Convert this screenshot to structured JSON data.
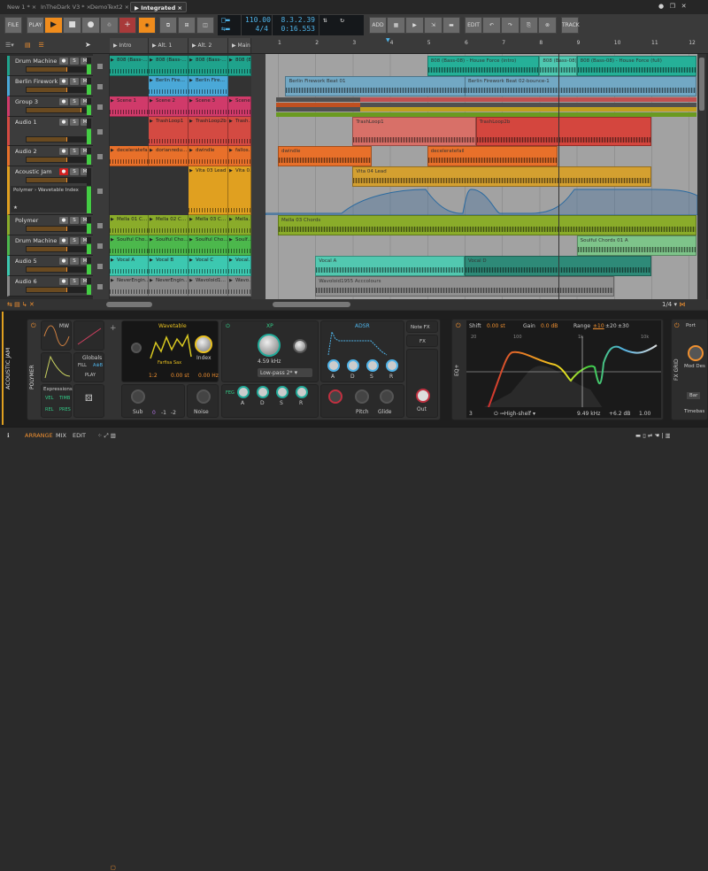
{
  "tabs": [
    {
      "label": "New 1 *"
    },
    {
      "label": "InTheDark V3 *"
    },
    {
      "label": "DemoText2"
    },
    {
      "label": "Integrated",
      "active": true
    }
  ],
  "toolbar": {
    "file": "FILE",
    "play": "PLAY",
    "add": "ADD",
    "edit": "EDIT",
    "track": "TRACK"
  },
  "transport": {
    "tempo": "110.00",
    "signature": "4/4",
    "position": "8.3.2.39",
    "time": "0:16.553"
  },
  "scenes": [
    "Intro",
    "Alt. 1",
    "Alt. 2",
    "Main"
  ],
  "ruler": [
    "1",
    "2",
    "3",
    "4",
    "5",
    "6",
    "7",
    "8",
    "9",
    "10",
    "11",
    "12"
  ],
  "colors": {
    "accent": "#f08c1c",
    "background": "#2b2b2b",
    "arranger": "#a0a0a0"
  },
  "tracks": [
    {
      "name": "Drum Machine",
      "color": "#1fa38c",
      "cells": [
        "808 (Bass-…",
        "808 (Bass-…",
        "808 (Bass-…",
        "808 (B…"
      ]
    },
    {
      "name": "Berlin Firework Kit",
      "color": "#4aa8d8",
      "cells": [
        "",
        "Berlin Fire…",
        "Berlin Fire…",
        ""
      ]
    },
    {
      "name": "Group 3",
      "color": "#d03a6a",
      "cells": [
        "Scene 1",
        "Scene 2",
        "Scene 3",
        "Scene"
      ]
    },
    {
      "name": "Audio 1",
      "color": "#d44a42",
      "cells": [
        "",
        "TrashLoop1",
        "TrashLoop2b",
        "Trash…"
      ]
    },
    {
      "name": "Audio 2",
      "color": "#e8702a",
      "cells": [
        "deceleratefall",
        "dorianredu…",
        "dwindle",
        "fallos…"
      ]
    },
    {
      "name": "Acoustic Jam",
      "color": "#e0a020",
      "cells": [
        "",
        "",
        "Vita 03 Lead",
        "Vita 0…"
      ],
      "device_path": "Polymer › Wavetable Index"
    },
    {
      "name": "Polymer",
      "color": "#8aac2a",
      "cells": [
        "Mella 01 C…",
        "Mella 02 C…",
        "Mella 03 C…",
        "Mella…"
      ]
    },
    {
      "name": "Drum Machine",
      "color": "#4cb84c",
      "cells": [
        "Soulful Cho…",
        "Soulful Cho…",
        "Soulful Cho…",
        "Soulf…"
      ]
    },
    {
      "name": "Audio 5",
      "color": "#3cc8b0",
      "cells": [
        "Vocal A",
        "Vocal B",
        "Vocal C",
        "Vocal…"
      ]
    },
    {
      "name": "Audio 6",
      "color": "#8a8a8a",
      "cells": [
        "NeverEngin…",
        "NeverEngin…",
        "Wavoloid1…",
        "Wavo…"
      ]
    }
  ],
  "clips": [
    {
      "track": 0,
      "start": 5.0,
      "end": 8.0,
      "name": "808 (Bass-08) - House Force (intro)",
      "color": "#25b098"
    },
    {
      "track": 0,
      "start": 8.0,
      "end": 9.0,
      "name": "808 (Bass-08)",
      "color": "#4ec8b0"
    },
    {
      "track": 0,
      "start": 9.0,
      "end": 12.2,
      "name": "808 (Bass-08) - House Force (full)",
      "color": "#25b098"
    },
    {
      "track": 1,
      "start": 1.2,
      "end": 6.2,
      "name": "Berlin Firework Beat 01",
      "color": "#72a8c4"
    },
    {
      "track": 1,
      "start": 6.0,
      "end": 12.2,
      "name": "Berlin Firework Beat 02-bounce-1",
      "color": "#72a8c4"
    },
    {
      "track": 3,
      "start": 3.0,
      "end": 6.3,
      "name": "TrashLoop1",
      "color": "#d87068"
    },
    {
      "track": 3,
      "start": 6.3,
      "end": 11.0,
      "name": "TrashLoop2b",
      "color": "#d4463e"
    },
    {
      "track": 4,
      "start": 1.0,
      "end": 3.5,
      "name": "dwindle",
      "color": "#e8702a"
    },
    {
      "track": 4,
      "start": 5.0,
      "end": 8.5,
      "name": "deceleratefail",
      "color": "#e8702a"
    },
    {
      "track": 5,
      "start": 3.0,
      "end": 11.0,
      "name": "Vita 04 Lead",
      "color": "#d4a030"
    },
    {
      "track": 6,
      "start": 1.0,
      "end": 12.2,
      "name": "Mella 03 Chords",
      "color": "#8aac2a"
    },
    {
      "track": 7,
      "start": 9.0,
      "end": 12.2,
      "name": "Soulful Chords 01 A",
      "color": "#7ec48a"
    },
    {
      "track": 8,
      "start": 2.0,
      "end": 6.0,
      "name": "Vocal A",
      "color": "#52c8b0"
    },
    {
      "track": 8,
      "start": 6.0,
      "end": 11.0,
      "name": "Vocal D",
      "color": "#2e8a78"
    },
    {
      "track": 9,
      "start": 2.0,
      "end": 10.0,
      "name": "Wavoloid1955 Acccolours",
      "color": "#909090"
    }
  ],
  "arranger_footer": {
    "grid": "1/4"
  },
  "device_panel": {
    "track_name": "ACOUSTIC JAM",
    "device": "POLYMER",
    "mod": {
      "lfo": "MW",
      "globals": "Globals",
      "fill": "FILL",
      "ab": "A⊕B",
      "play": "PLAY",
      "expressions": "Expressions",
      "vel": "VEL",
      "timb": "TIMB",
      "rel": "REL",
      "pres": "PRES"
    },
    "osc": {
      "type": "Wavetable",
      "wavetable": "Farfisa Sax",
      "index": "Index",
      "ratio": "1:2",
      "pitch": "0.00 st",
      "freq": "0.00 Hz",
      "sub": "Sub",
      "sub_oct": [
        "0",
        "-1",
        "-2"
      ],
      "noise": "Noise"
    },
    "filter": {
      "type": "XP",
      "cutoff": "4.59 kHz",
      "mode": "Low-pass 2*",
      "feg": "FEG",
      "adsr": [
        "A",
        "D",
        "S",
        "R"
      ]
    },
    "amp": {
      "env": "ADSR",
      "adsr": [
        "A",
        "D",
        "S",
        "R"
      ],
      "pitch": "Pitch",
      "glide": "Glide",
      "note_fx": "Note FX",
      "fx": "FX",
      "out": "Out"
    },
    "eq": {
      "name": "EQ+",
      "shift_label": "Shift",
      "shift": "0.00 st",
      "gain_label": "Gain",
      "gain": "0.0 dB",
      "range_label": "Range",
      "ranges": [
        "±10",
        "±20",
        "±30"
      ],
      "freqs": [
        "20",
        "100",
        "1k",
        "10k"
      ],
      "band": "3",
      "band_type": "High-shelf",
      "band_freq": "9.49 kHz",
      "band_gain": "+6.2 dB",
      "band_q": "1.00"
    },
    "fxgrid": {
      "name": "FX GRID",
      "port": "Port",
      "mod_dest": "Mod Des",
      "bar": "Bar",
      "timebase": "Timebas"
    }
  },
  "status": {
    "arrange": "ARRANGE",
    "mix": "MIX",
    "edit": "EDIT"
  }
}
